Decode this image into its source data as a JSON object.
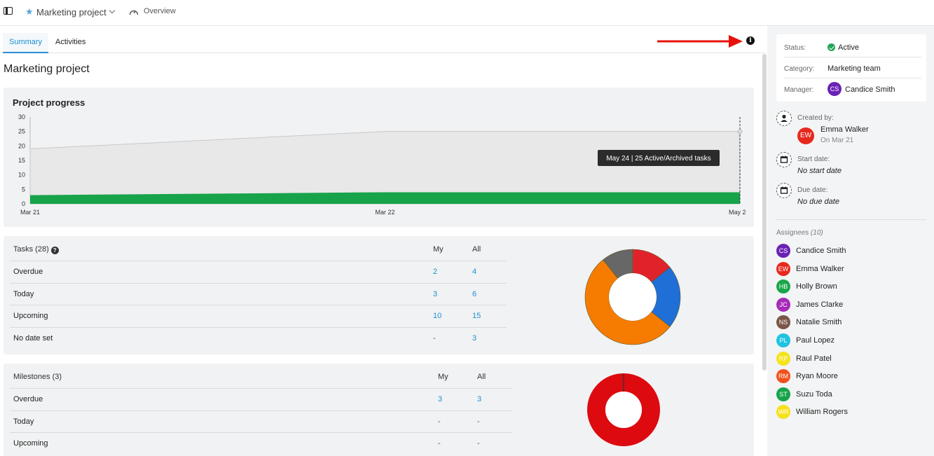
{
  "topbar": {
    "project_name": "Marketing project",
    "overview": "Overview"
  },
  "tabs": [
    {
      "label": "Summary",
      "active": true
    },
    {
      "label": "Activities",
      "active": false
    }
  ],
  "page_title": "Marketing project",
  "progress": {
    "title": "Project progress",
    "tooltip": "May 24 | 25 Active/Archived tasks",
    "chart_data": {
      "type": "area",
      "x": [
        "Mar 21",
        "Mar 22",
        "May 24"
      ],
      "x_tick_labels": [
        "Mar 21",
        "Mar 22",
        "May 2"
      ],
      "y_ticks": [
        0,
        5,
        10,
        15,
        20,
        25,
        30
      ],
      "ylim": [
        0,
        30
      ],
      "series": [
        {
          "values": [
            19,
            25,
            25
          ],
          "color": "#e8e8e8"
        },
        {
          "values": [
            3,
            4,
            4
          ],
          "color": "#17a34a"
        }
      ]
    }
  },
  "tasks": {
    "title": "Tasks (28)",
    "col_my": "My",
    "col_all": "All",
    "rows": [
      {
        "label": "Overdue",
        "my": "2",
        "all": "4"
      },
      {
        "label": "Today",
        "my": "3",
        "all": "6"
      },
      {
        "label": "Upcoming",
        "my": "10",
        "all": "15"
      },
      {
        "label": "No date set",
        "my": "-",
        "all": "3"
      }
    ],
    "chart_data": {
      "type": "pie",
      "values": [
        4,
        6,
        15,
        3
      ],
      "colors": [
        "#e0232a",
        "#1f6fd6",
        "#f57c00",
        "#676767"
      ]
    }
  },
  "milestones": {
    "title": "Milestones (3)",
    "col_my": "My",
    "col_all": "All",
    "rows": [
      {
        "label": "Overdue",
        "my": "3",
        "all": "3"
      },
      {
        "label": "Today",
        "my": "-",
        "all": "-"
      },
      {
        "label": "Upcoming",
        "my": "-",
        "all": "-"
      }
    ],
    "chart_data": {
      "type": "pie",
      "values": [
        3
      ],
      "colors": [
        "#dd0a10"
      ]
    }
  },
  "sidebar": {
    "status_label": "Status:",
    "status_value": "Active",
    "category_label": "Category:",
    "category_value": "Marketing team",
    "manager_label": "Manager:",
    "manager_initials": "CS",
    "manager_name": "Candice Smith",
    "created_label": "Created by:",
    "created_initials": "EW",
    "created_name": "Emma Walker",
    "created_on": "On Mar 21",
    "start_label": "Start date:",
    "start_value": "No start date",
    "due_label": "Due date:",
    "due_value": "No due date",
    "assignees_label": "Assignees",
    "assignees_count": "(10)",
    "assignees": [
      {
        "initials": "CS",
        "name": "Candice Smith",
        "color": "#6a22b5"
      },
      {
        "initials": "EW",
        "name": "Emma Walker",
        "color": "#e8281c"
      },
      {
        "initials": "HB",
        "name": "Holly Brown",
        "color": "#1aa64a"
      },
      {
        "initials": "JC",
        "name": "James Clarke",
        "color": "#a52bb8"
      },
      {
        "initials": "NS",
        "name": "Natalie Smith",
        "color": "#7b5548"
      },
      {
        "initials": "PL",
        "name": "Paul Lopez",
        "color": "#1ec3e0"
      },
      {
        "initials": "RP",
        "name": "Raul Patel",
        "color": "#f5e31a"
      },
      {
        "initials": "RM",
        "name": "Ryan Moore",
        "color": "#f0511c"
      },
      {
        "initials": "ST",
        "name": "Suzu Toda",
        "color": "#16a34a"
      },
      {
        "initials": "WR",
        "name": "William Rogers",
        "color": "#f7e017"
      }
    ]
  }
}
